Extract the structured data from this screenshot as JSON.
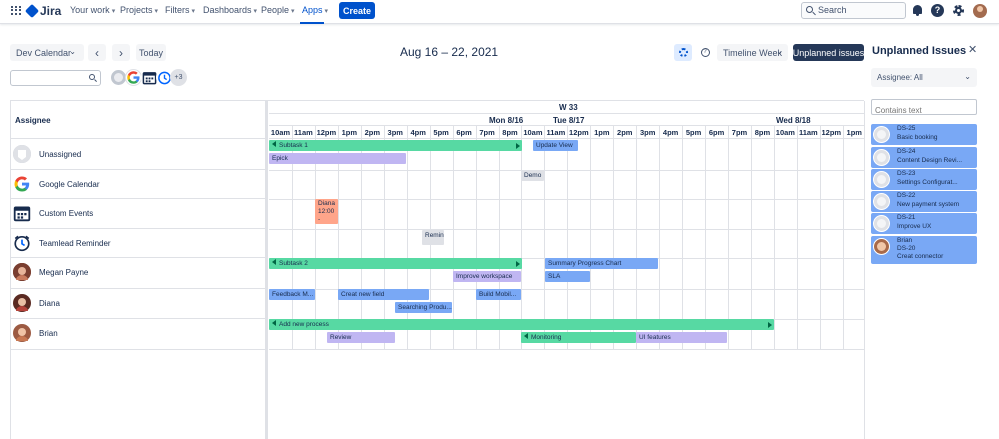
{
  "nav": {
    "product": "Jira",
    "items": [
      "Your work",
      "Projects",
      "Filters",
      "Dashboards",
      "People",
      "Apps"
    ],
    "create_label": "Create",
    "search_placeholder": "Search",
    "help_glyph": "?"
  },
  "toolbar": {
    "calendar_select": "Dev Calendar",
    "prev_glyph": "‹",
    "next_glyph": "›",
    "today_label": "Today",
    "date_range": "Aug 16 – 22, 2021",
    "view_select": "Timeline Week",
    "unplanned_button": "Unplanned issues",
    "avatar_more": "+3"
  },
  "calendar": {
    "assignee_header": "Assignee",
    "week_label": "W 33",
    "days": [
      "Mon 8/16",
      "Tue 8/17",
      "Wed 8/18"
    ],
    "hours": [
      "10am",
      "11am",
      "12pm",
      "1pm",
      "2pm",
      "3pm",
      "4pm",
      "5pm",
      "6pm",
      "7pm",
      "8pm",
      "10am",
      "11am",
      "12pm",
      "1pm",
      "2pm",
      "3pm",
      "4pm",
      "5pm",
      "6pm",
      "7pm",
      "8pm",
      "10am",
      "11am",
      "12pm",
      "1pm"
    ],
    "resources": [
      {
        "name": "Unassigned",
        "icon": "unassigned-avatar-icon"
      },
      {
        "name": "Google Calendar",
        "icon": "google-icon"
      },
      {
        "name": "Custom Events",
        "icon": "calendar-icon"
      },
      {
        "name": "Teamlead Reminder",
        "icon": "alarm-clock-icon"
      },
      {
        "name": "Megan Payne",
        "icon": "avatar"
      },
      {
        "name": "Diana",
        "icon": "avatar"
      },
      {
        "name": "Brian",
        "icon": "avatar"
      }
    ],
    "events": {
      "subtask1": "Subtask 1",
      "update_view": "Update View",
      "epick": "Epick",
      "demo": "Demo",
      "diana_english": "Diana 12:00 - English",
      "remind": "Remind",
      "subtask2": "Subtask 2",
      "summary_progress": "Summary Progress Chart",
      "improve_workspace": "Improve workspace",
      "sla": "SLA",
      "feedback": "Feedback M...",
      "create_field": "Creat new field",
      "build_mobile": "Build Mobil...",
      "searching": "Searching Produ...",
      "add_process": "Add new process",
      "review": "Review",
      "monitoring": "Monitoring",
      "ui_features": "UI features"
    }
  },
  "unplanned": {
    "title": "Unplanned Issues",
    "close_glyph": "✕",
    "assignee_filter": "Assignee: All",
    "contains_placeholder": "Contains text",
    "issues": [
      {
        "key": "DS-25",
        "title": "Basic booking"
      },
      {
        "key": "DS-24",
        "title": "Content Design Revi..."
      },
      {
        "key": "DS-23",
        "title": "Settings Configurat..."
      },
      {
        "key": "DS-22",
        "title": "New payment system"
      },
      {
        "key": "DS-21",
        "title": "Improve UX"
      },
      {
        "assignee": "Brian",
        "key": "DS-20",
        "title": "Creat connector"
      }
    ]
  },
  "colors": {
    "accent": "#0052cc",
    "green_event": "#57d9a3",
    "purple_event": "#c0b6f2",
    "blue_event": "#79a8f5",
    "salmon_event": "#ffa58a",
    "dark_button": "#253858"
  }
}
